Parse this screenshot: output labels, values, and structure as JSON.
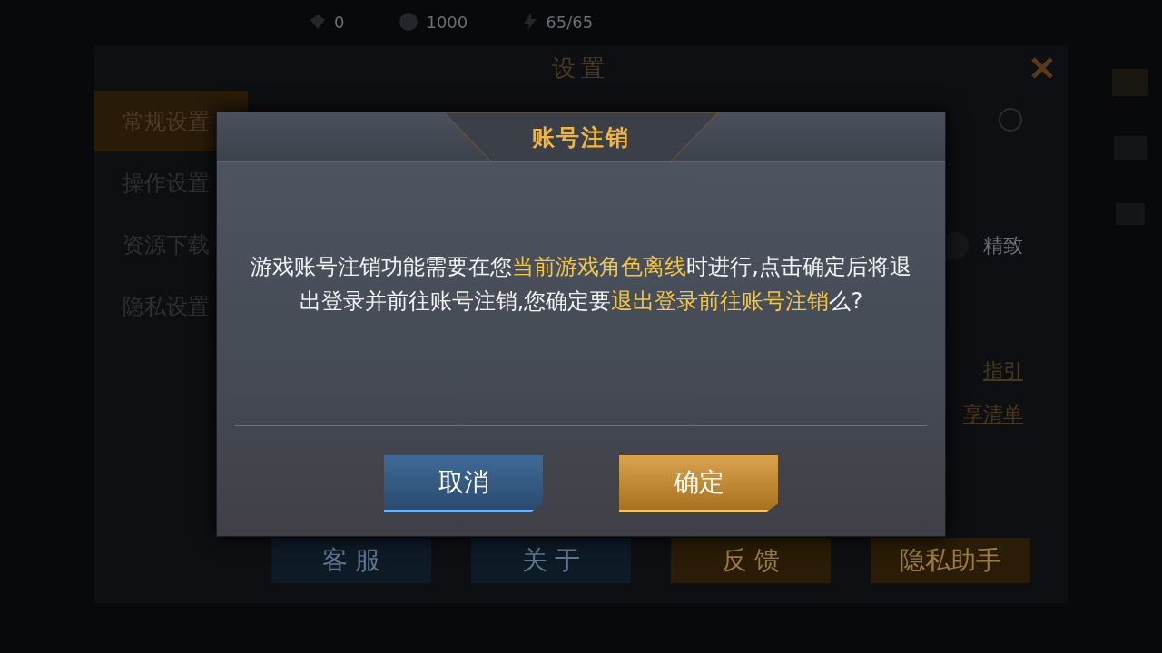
{
  "top_bar": {
    "stats": [
      {
        "kind": "diamond",
        "value": "0"
      },
      {
        "kind": "coin",
        "value": "1000"
      },
      {
        "kind": "energy",
        "value": "65/65"
      }
    ]
  },
  "settings": {
    "title": "设置",
    "menu": [
      {
        "label": "常规设置",
        "selected": true
      },
      {
        "label": "操作设置",
        "selected": false
      },
      {
        "label": "资源下载",
        "selected": false
      },
      {
        "label": "隐私设置",
        "selected": false
      }
    ],
    "quality_option": {
      "label": "精致",
      "selected": false
    },
    "links": [
      "指引",
      "享清单"
    ],
    "buttons": [
      {
        "label": "客 服",
        "kind": "blue"
      },
      {
        "label": "关 于",
        "kind": "blue"
      },
      {
        "label": "反 馈",
        "kind": "gold"
      },
      {
        "label": "隐私助手",
        "kind": "gold"
      }
    ]
  },
  "dialog": {
    "title": "账号注销",
    "message": [
      {
        "text": "游戏账号注销功能需要在您",
        "highlight": false
      },
      {
        "text": "当前游戏角色离线",
        "highlight": true
      },
      {
        "text": "时进行,点击确定后将退出登录并前往账号注销,您确定要",
        "highlight": false
      },
      {
        "text": "退出登录前往账号注销",
        "highlight": true
      },
      {
        "text": "么?",
        "highlight": false
      }
    ],
    "buttons": [
      {
        "label": "取消",
        "kind": "blue"
      },
      {
        "label": "确定",
        "kind": "gold"
      }
    ]
  }
}
